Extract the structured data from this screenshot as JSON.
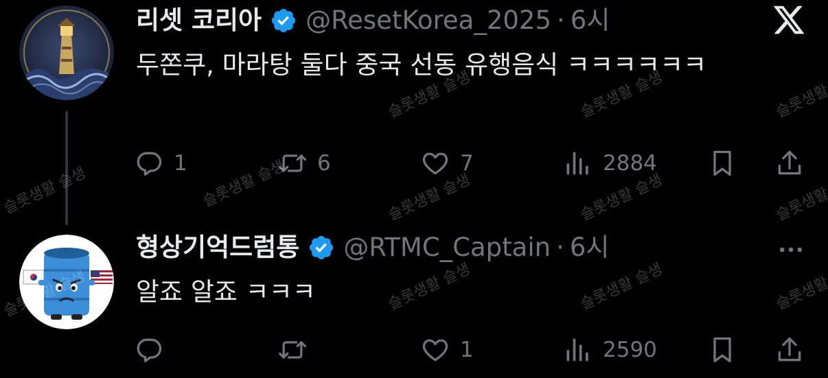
{
  "tweets": [
    {
      "display_name": "리셋 코리아",
      "handle": "@ResetKorea_2025",
      "separator": "·",
      "time": "6시",
      "text": "두쫀쿠, 마라탕 둘다 중국 선동 유행음식 ㅋㅋㅋㅋㅋㅋ",
      "counts": {
        "reply": "1",
        "retweet": "6",
        "like": "7",
        "views": "2884"
      }
    },
    {
      "display_name": "형상기억드럼통",
      "handle": "@RTMC_Captain",
      "separator": "·",
      "time": "6시",
      "text": "알죠 알죠 ㅋㅋㅋ",
      "counts": {
        "reply": "",
        "retweet": "",
        "like": "1",
        "views": "2590"
      }
    }
  ],
  "watermark": "슬롯생활 슬생",
  "colors": {
    "background": "#000000",
    "primary_text": "#e7e9ea",
    "secondary_text": "#71767b",
    "verified_blue": "#1d9bf0",
    "thread_line": "#333639"
  },
  "icons": [
    "verified-badge-icon",
    "x-logo-icon",
    "more-options-icon",
    "reply-icon",
    "retweet-icon",
    "like-icon",
    "views-icon",
    "bookmark-icon",
    "share-icon"
  ]
}
